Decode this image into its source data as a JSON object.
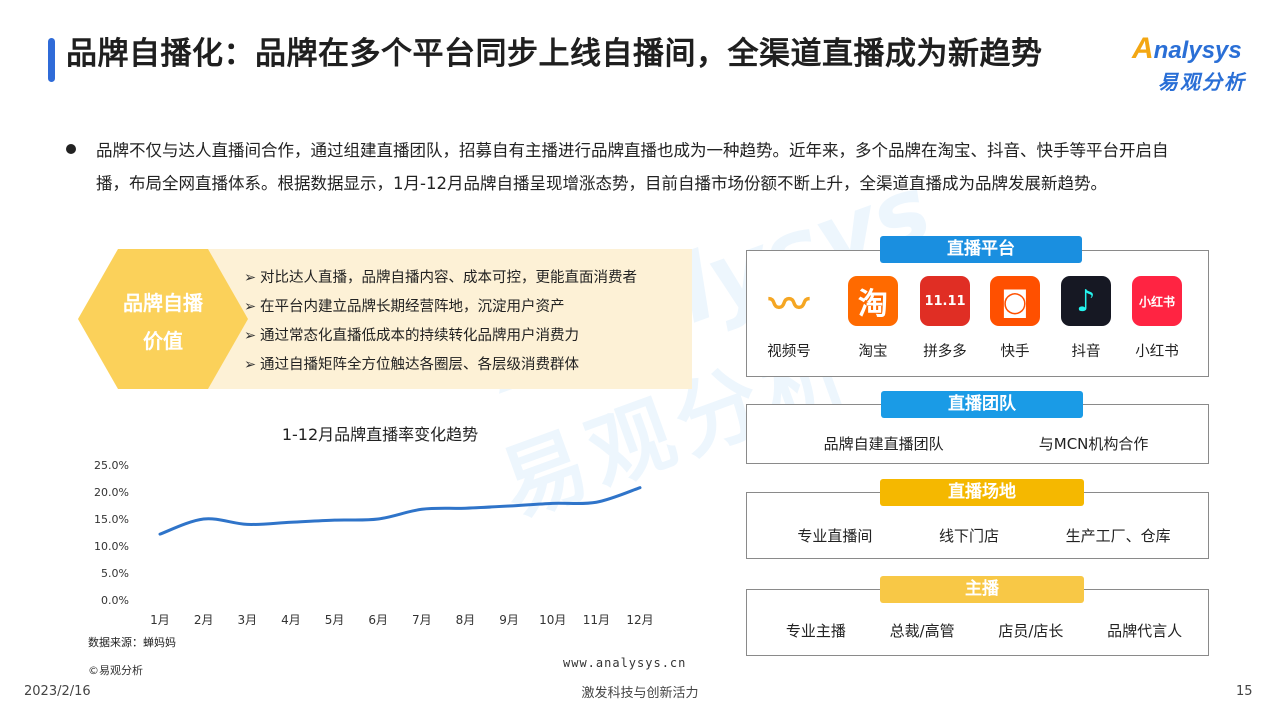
{
  "title": "品牌自播化：品牌在多个平台同步上线自播间，全渠道直播成为新趋势",
  "logo": {
    "en_first": "A",
    "en_rest": "nalysys",
    "cn": "易观分析"
  },
  "bullet": "品牌不仅与达人直播间合作，通过组建直播团队，招募自有主播进行品牌直播也成为一种趋势。近年来，多个品牌在淘宝、抖音、快手等平台开启自播，布局全网直播体系。根据数据显示，1月-12月品牌自播呈现增涨态势，目前自播市场份额不断上升，全渠道直播成为品牌发展新趋势。",
  "value": {
    "label_line1": "品牌自播",
    "label_line2": "价值",
    "arrow": "➢",
    "items": [
      "对比达人直播，品牌自播内容、成本可控，更能直面消费者",
      "在平台内建立品牌长期经营阵地，沉淀用户资产",
      "通过常态化直播低成本的持续转化品牌用户消费力",
      "通过自播矩阵全方位触达各圈层、各层级消费群体"
    ]
  },
  "chart_data": {
    "type": "line",
    "title": "1-12月品牌直播率变化趋势",
    "categories": [
      "1月",
      "2月",
      "3月",
      "4月",
      "5月",
      "6月",
      "7月",
      "8月",
      "9月",
      "10月",
      "11月",
      "12月"
    ],
    "series": [
      {
        "values": [
          12.2,
          15.0,
          14.0,
          14.4,
          14.8,
          15.0,
          16.8,
          17.0,
          17.4,
          17.9,
          18.1,
          20.8
        ]
      }
    ],
    "ylim": [
      0,
      25
    ],
    "yticks": [
      "0.0%",
      "5.0%",
      "10.0%",
      "15.0%",
      "20.0%",
      "25.0%"
    ],
    "grid": false,
    "color": "#2f74c9"
  },
  "source": "数据来源：蝉妈妈",
  "copyright": "©易观分析",
  "website": "www.analysys.cn",
  "footer": {
    "date": "2023/2/16",
    "slogan": "激发科技与创新活力",
    "page": "15"
  },
  "watermark": {
    "en": "Analysys",
    "cn": "易观分析"
  },
  "platforms": {
    "header": "直播平台",
    "items": [
      {
        "label": "视频号",
        "glyph": "〰"
      },
      {
        "label": "淘宝",
        "glyph": "淘"
      },
      {
        "label": "拼多多",
        "glyph": "11.11"
      },
      {
        "label": "快手",
        "glyph": "◙"
      },
      {
        "label": "抖音",
        "glyph": "♪"
      },
      {
        "label": "小红书",
        "glyph": "小红书"
      }
    ]
  },
  "team": {
    "header": "直播团队",
    "items": [
      "品牌自建直播团队",
      "与MCN机构合作"
    ]
  },
  "venue": {
    "header": "直播场地",
    "items": [
      "专业直播间",
      "线下门店",
      "生产工厂、仓库"
    ]
  },
  "host": {
    "header": "主播",
    "items": [
      "专业主播",
      "总裁/高管",
      "店员/店长",
      "品牌代言人"
    ]
  },
  "colors": {
    "accent_blue": "#1a8fe0",
    "team_blue": "#1a9be6",
    "venue_yellow": "#f5b800",
    "host_yellow": "#f8c846",
    "hex_yellow": "#fbd15a",
    "value_bg": "#fdf1d6",
    "line": "#2f74c9"
  }
}
